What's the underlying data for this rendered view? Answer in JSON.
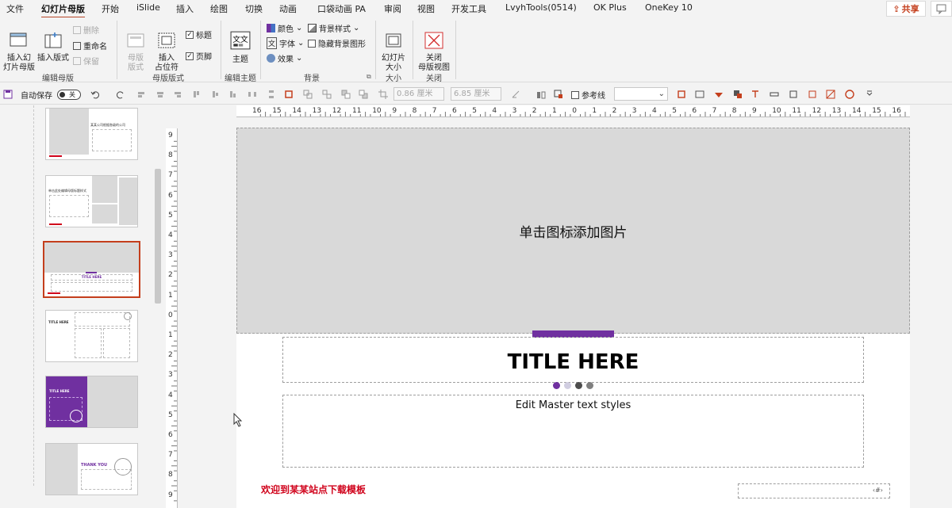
{
  "tabs": [
    {
      "label": "文件",
      "active": false
    },
    {
      "label": "幻灯片母版",
      "active": true
    },
    {
      "label": "开始",
      "active": false
    },
    {
      "label": "iSlide",
      "active": false
    },
    {
      "label": "插入",
      "active": false
    },
    {
      "label": "绘图",
      "active": false
    },
    {
      "label": "切换",
      "active": false
    },
    {
      "label": "动画",
      "active": false
    },
    {
      "label": "口袋动画 PA",
      "active": false
    },
    {
      "label": "审阅",
      "active": false
    },
    {
      "label": "视图",
      "active": false
    },
    {
      "label": "开发工具",
      "active": false
    },
    {
      "label": "LvyhTools(0514)",
      "active": false
    },
    {
      "label": "OK Plus",
      "active": false
    },
    {
      "label": "OneKey 10",
      "active": false
    }
  ],
  "share_label": "共享",
  "ribbon": {
    "insert_master": "插入幻\n灯片母版",
    "insert_layout": "插入版式",
    "delete": "删除",
    "rename": "重命名",
    "preserve": "保留",
    "group_edit_master": "编辑母版",
    "master_layout": "母版\n版式",
    "insert_placeholder": "插入\n占位符",
    "title_check": "标题",
    "footer_check": "页脚",
    "group_master_layout": "母版版式",
    "themes": "主题",
    "group_edit_theme": "编辑主题",
    "colors": "颜色",
    "fonts": "字体",
    "effects": "效果",
    "bg_styles": "背景样式",
    "hide_bg": "隐藏背景图形",
    "group_background": "背景",
    "slide_size": "幻灯片\n大小",
    "group_size": "大小",
    "close_master": "关闭\n母版视图",
    "group_close": "关闭"
  },
  "qat": {
    "autosave": "自动保存",
    "toggle_state": "关",
    "height_value": "0.86 厘米",
    "width_value": "6.85 厘米",
    "guides": "参考线"
  },
  "ruler": {
    "h_labels": [
      "16",
      "15",
      "14",
      "13",
      "12",
      "11",
      "10",
      "9",
      "8",
      "7",
      "6",
      "5",
      "4",
      "3",
      "2",
      "1",
      "0",
      "1",
      "2",
      "3",
      "4",
      "5",
      "6",
      "7",
      "8",
      "9",
      "10",
      "11",
      "12",
      "13",
      "14",
      "15",
      "16"
    ],
    "v_labels": [
      "9",
      "8",
      "7",
      "6",
      "5",
      "4",
      "3",
      "2",
      "1",
      "0",
      "1",
      "2",
      "3",
      "4",
      "5",
      "6",
      "7",
      "8",
      "9"
    ]
  },
  "slide": {
    "picture_placeholder": "单击图标添加图片",
    "title": "TITLE HERE",
    "body": "Edit Master text styles",
    "footer": "欢迎到某某站点下载模板",
    "page_number": "‹#›",
    "accent_color": "#7030a0",
    "dot_colors": [
      "#7030a0",
      "#d0cde0",
      "#4d4d4d",
      "#7f7f7f"
    ]
  },
  "thumbnails": [
    {
      "title": "某某公司根据各级的公司",
      "selected": false
    },
    {
      "title": "单击此处编辑母版标题样式",
      "selected": false
    },
    {
      "title": "TITLE HERE",
      "selected": true
    },
    {
      "title": "TITLE HERE",
      "selected": false
    },
    {
      "title": "TITLE HERE",
      "selected": false
    },
    {
      "title": "THANK YOU",
      "selected": false
    }
  ]
}
